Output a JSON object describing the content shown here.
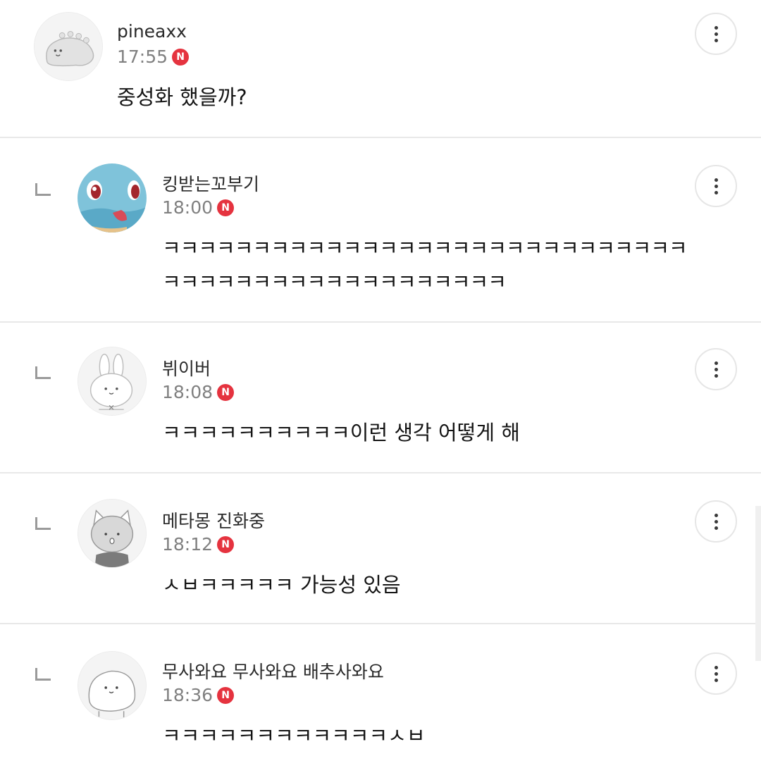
{
  "comments": [
    {
      "author": "pineaxx",
      "time": "17:55",
      "badge": "N",
      "text": [
        "중성화 했을까?"
      ],
      "avatar_icon": "dinosaur-avatar-icon"
    },
    {
      "author": "킹받는꼬부기",
      "time": "18:00",
      "badge": "N",
      "text": [
        "ㅋㅋㅋㅋㅋㅋㅋㅋㅋㅋㅋㅋㅋㅋㅋㅋㅋㅋㅋㅋㅋㅋㅋㅋㅋㅋㅋㅋㅋ",
        "ㅋㅋㅋㅋㅋㅋㅋㅋㅋㅋㅋㅋㅋㅋㅋㅋㅋㅋㅋ"
      ],
      "avatar_icon": "squirtle-avatar-icon"
    },
    {
      "author": "뷔이버",
      "time": "18:08",
      "badge": "N",
      "text": [
        "ㅋㅋㅋㅋㅋㅋㅋㅋㅋㅋ이런 생각 어떻게 해"
      ],
      "avatar_icon": "rabbit-avatar-icon"
    },
    {
      "author": "메타몽 진화중",
      "time": "18:12",
      "badge": "N",
      "text": [
        "ㅅㅂㅋㅋㅋㅋㅋ 가능성 있음"
      ],
      "avatar_icon": "cat-avatar-icon"
    },
    {
      "author": "무사와요 무사와요 배추사와요",
      "time": "18:36",
      "badge": "N",
      "text": [
        "ㅋㅋㅋㅋㅋㅋㅋㅋㅋㅋㅋㅋㅅㅂ"
      ],
      "avatar_icon": "blob-avatar-icon"
    }
  ],
  "colors": {
    "badge": "#e5333f",
    "divider": "#e8e8e8",
    "time": "#808080"
  }
}
